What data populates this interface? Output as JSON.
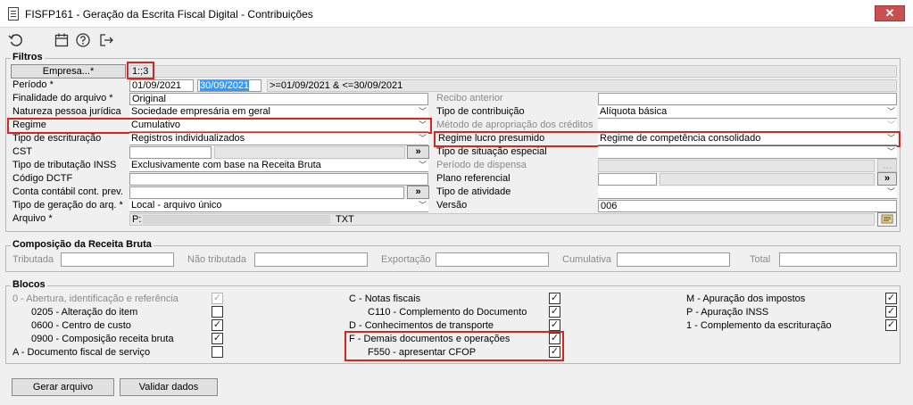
{
  "window": {
    "title": "FISFP161 - Geração da Escrita Fiscal Digital - Contribuições",
    "close": "✕"
  },
  "toolbar": {
    "icons": [
      "refresh-icon",
      "calendar-icon",
      "help-icon",
      "exit-icon"
    ]
  },
  "filtros": {
    "title": "Filtros",
    "empresa_btn": "Empresa...*",
    "empresa_value": "1:;3",
    "periodo_label": "Período *",
    "periodo_start": "01/09/2021",
    "periodo_end": "30/09/2021",
    "periodo_summary": ">=01/09/2021 & <=30/09/2021",
    "finalidade_label": "Finalidade do arquivo *",
    "finalidade_value": "Original",
    "recibo_label": "Recibo anterior",
    "natureza_label": "Natureza pessoa jurídica",
    "natureza_value": "Sociedade empresária em geral",
    "tipo_contrib_label": "Tipo de contribuição",
    "tipo_contrib_value": "Alíquota básica",
    "regime_label": "Regime",
    "regime_value": "Cumulativo",
    "metodo_label": "Método de apropriação dos créditos",
    "tipo_escrit_label": "Tipo de escrituração",
    "tipo_escrit_value": "Registros individualizados",
    "regime_lucro_label": "Regime lucro presumido",
    "regime_lucro_value": "Regime de competência consolidado",
    "cst_label": "CST",
    "cst_btn": "»",
    "tipo_situacao_label": "Tipo de situação especial",
    "tipo_trib_inss_label": "Tipo de tributação INSS",
    "tipo_trib_inss_value": "Exclusivamente com base na Receita Bruta",
    "periodo_dispensa_label": "Período de dispensa",
    "codigo_dctf_label": "Código DCTF",
    "plano_ref_label": "Plano referencial",
    "plano_ref_btn": "»",
    "conta_contabil_label": "Conta contábil cont. prev.",
    "conta_contabil_btn": "»",
    "tipo_atividade_label": "Tipo de atividade",
    "tipo_geracao_label": "Tipo de geração do arq. *",
    "tipo_geracao_value": "Local - arquivo único",
    "versao_label": "Versão",
    "versao_value": "006",
    "arquivo_label": "Arquivo *",
    "arquivo_prefix": "P:",
    "arquivo_suffix": "TXT"
  },
  "composicao": {
    "title": "Composição da Receita Bruta",
    "tributada": "Tributada",
    "nao_tributada": "Não tributada",
    "exportacao": "Exportação",
    "cumulativa": "Cumulativa",
    "total": "Total"
  },
  "blocos": {
    "title": "Blocos",
    "col1": [
      {
        "label": "0 - Abertura, identificação e referência",
        "checked": true,
        "disabled": true
      },
      {
        "label": "0205 - Alteração do item",
        "checked": false,
        "disabled": false
      },
      {
        "label": "0600 - Centro de custo",
        "checked": true,
        "disabled": false
      },
      {
        "label": "0900 - Composição receita bruta",
        "checked": true,
        "disabled": false
      },
      {
        "label": "A - Documento fiscal de serviço",
        "checked": false,
        "disabled": false
      }
    ],
    "col2": [
      {
        "label": "C - Notas fiscais",
        "checked": true
      },
      {
        "label": "C110 - Complemento do Documento",
        "checked": true
      },
      {
        "label": "D - Conhecimentos de transporte",
        "checked": true
      },
      {
        "label": "F - Demais documentos e operações",
        "checked": true
      },
      {
        "label": "F550 - apresentar CFOP",
        "checked": true
      }
    ],
    "col3": [
      {
        "label": "M - Apuração dos impostos",
        "checked": true
      },
      {
        "label": "P - Apuração INSS",
        "checked": true
      },
      {
        "label": "1 - Complemento da escrituração",
        "checked": true
      }
    ]
  },
  "buttons": {
    "gerar": "Gerar arquivo",
    "validar": "Validar dados"
  },
  "check_mark": "✓",
  "colors": {
    "highlight": "#d9251d",
    "selection": "#3399ff"
  }
}
